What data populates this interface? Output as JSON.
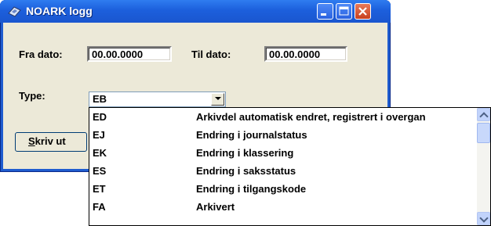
{
  "window": {
    "title": "NOARK logg"
  },
  "form": {
    "fra_dato_label": "Fra dato:",
    "fra_dato_value": "00.00.0000",
    "til_dato_label": "Til dato:",
    "til_dato_value": "00.00.0000",
    "type_label": "Type:",
    "type_value": "EB"
  },
  "button": {
    "print_label_hotkey": "S",
    "print_label_rest": "kriv ut"
  },
  "dropdown": {
    "items": [
      {
        "code": "ED",
        "description": "Arkivdel automatisk endret, registrert i overgan"
      },
      {
        "code": "EJ",
        "description": "Endring i journalstatus"
      },
      {
        "code": "EK",
        "description": "Endring i klassering"
      },
      {
        "code": "ES",
        "description": "Endring i saksstatus"
      },
      {
        "code": "ET",
        "description": "Endring i tilgangskode"
      },
      {
        "code": "FA",
        "description": "Arkivert"
      }
    ]
  }
}
